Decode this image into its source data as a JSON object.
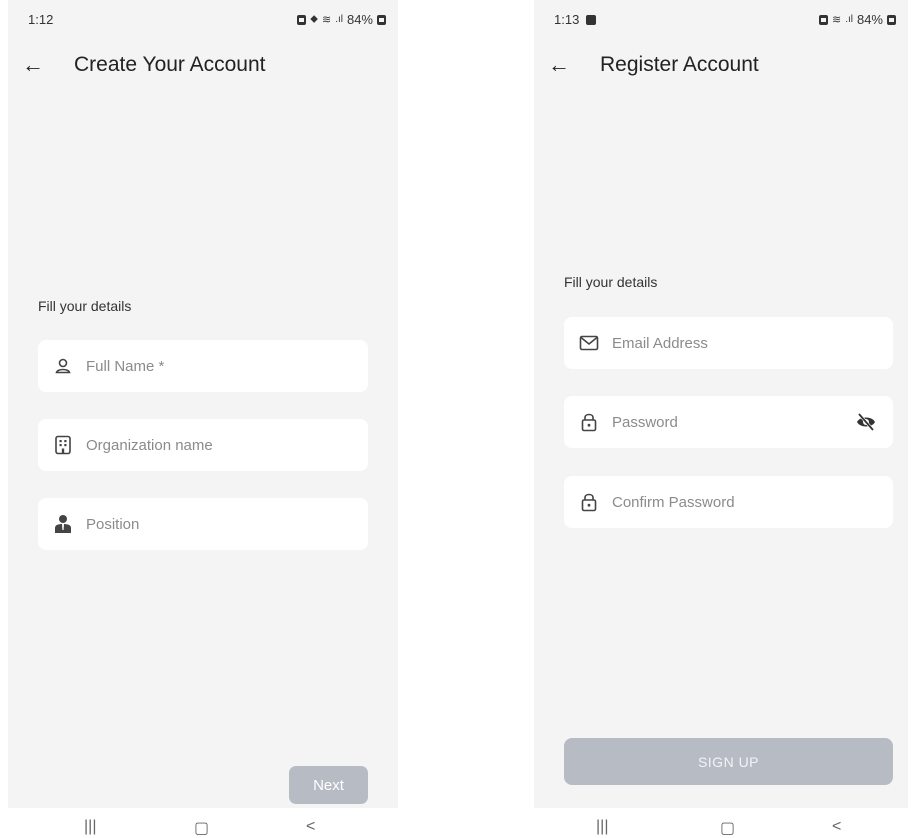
{
  "left": {
    "status": {
      "time": "1:12",
      "battery": "84%"
    },
    "title": "Create Your Account",
    "section_label": "Fill your details",
    "fields": [
      {
        "placeholder": "Full Name *",
        "icon": "person-icon"
      },
      {
        "placeholder": "Organization name",
        "icon": "building-icon"
      },
      {
        "placeholder": "Position",
        "icon": "employee-icon"
      }
    ],
    "next_label": "Next"
  },
  "right": {
    "status": {
      "time": "1:13",
      "battery": "84%"
    },
    "title": "Register Account",
    "section_label": "Fill your details",
    "fields": [
      {
        "placeholder": "Email Address",
        "icon": "mail-icon"
      },
      {
        "placeholder": "Password",
        "icon": "lock-icon"
      },
      {
        "placeholder": "Confirm Password",
        "icon": "lock-icon"
      }
    ],
    "signup_label": "SIGN UP"
  },
  "colors": {
    "screen_bg": "#f4f4f4",
    "field_bg": "#ffffff",
    "button_bg": "#b7bbc4"
  },
  "nav": {
    "recents": "|||",
    "home": "▢",
    "back": "<"
  }
}
